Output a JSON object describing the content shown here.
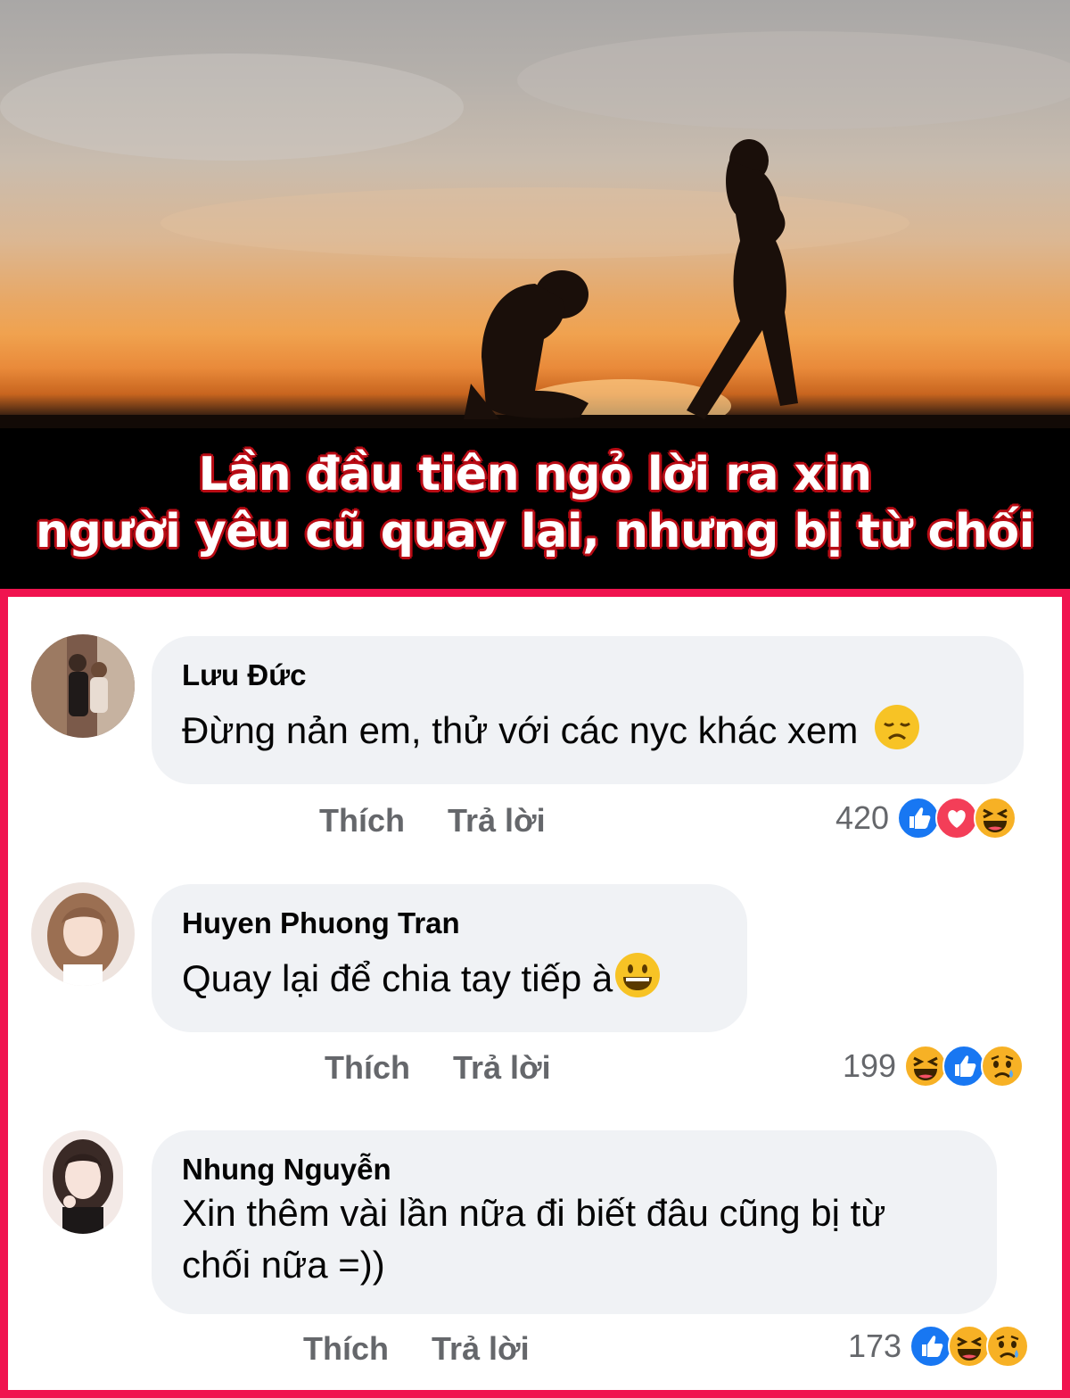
{
  "banner": {
    "caption_line1": "Lần đầu tiên ngỏ lời ra xin",
    "caption_line2": "người yêu cũ quay lại, nhưng bị từ chối"
  },
  "comments": [
    {
      "author": "Lưu Đức",
      "text": "Đừng nản em, thử với các nyc khác xem",
      "inline_emoji": "disappointed-face-icon",
      "like_label": "Thích",
      "reply_label": "Trả lời",
      "reaction_count": "420",
      "reactions": [
        "like",
        "love",
        "haha"
      ]
    },
    {
      "author": "Huyen Phuong Tran",
      "text": "Quay lại để chia tay tiếp à",
      "inline_emoji": "grinning-face-icon",
      "like_label": "Thích",
      "reply_label": "Trả lời",
      "reaction_count": "199",
      "reactions": [
        "haha",
        "like",
        "sad"
      ]
    },
    {
      "author": "Nhung Nguyễn",
      "text_line1": "Xin thêm vài lần nữa đi biết đâu cũng bị từ",
      "text_line2": "chối nữa =))",
      "like_label": "Thích",
      "reply_label": "Trả lời",
      "reaction_count": "173",
      "reactions": [
        "like",
        "haha",
        "sad"
      ]
    }
  ],
  "colors": {
    "frame": "#f0134f",
    "caption_outline": "#b80b14",
    "bubble": "#f0f2f5",
    "secondary_text": "#65676b",
    "like_blue": "#1877f2",
    "love_red": "#f33e58",
    "emoji_yellow": "#f7b125"
  }
}
